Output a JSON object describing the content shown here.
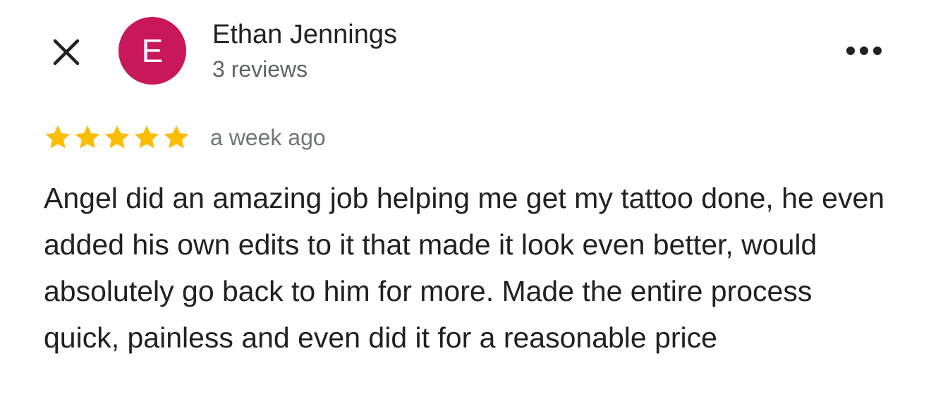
{
  "reviewer": {
    "name": "Ethan Jennings",
    "review_count": "3 reviews",
    "avatar_initial": "E",
    "avatar_color": "#C8175A"
  },
  "review": {
    "rating": 5,
    "max_rating": 5,
    "star_color": "#FBBC04",
    "time_ago": "a week ago",
    "text": "Angel did an amazing job helping me get my tattoo done, he even added his own edits to it that made it look even better, would absolutely go back to him for more. Made the entire process quick, painless and even did it for a reasonable price"
  },
  "icons": {
    "close": "close-icon",
    "more": "more-horizontal-icon",
    "star": "star-icon"
  }
}
